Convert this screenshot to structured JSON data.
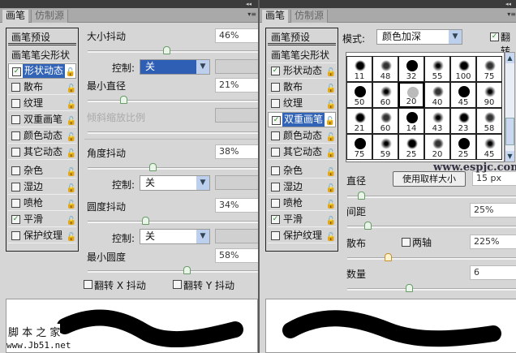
{
  "tabs": {
    "brush": "画笔",
    "clone_source": "仿制源",
    "collapse": "◂◂",
    "menu": "▾≡"
  },
  "left": {
    "list": [
      {
        "label": "画笔预设",
        "type": "head"
      },
      {
        "label": "画笔笔尖形状",
        "type": "head"
      },
      {
        "label": "形状动态",
        "checked": true,
        "selected": true
      },
      {
        "label": "散布",
        "checked": false
      },
      {
        "label": "纹理",
        "checked": false
      },
      {
        "label": "双重画笔",
        "checked": false
      },
      {
        "label": "颜色动态",
        "checked": false
      },
      {
        "label": "其它动态",
        "checked": false
      },
      {
        "label": "杂色",
        "checked": false
      },
      {
        "label": "湿边",
        "checked": false
      },
      {
        "label": "喷枪",
        "checked": false
      },
      {
        "label": "平滑",
        "checked": true
      },
      {
        "label": "保护纹理",
        "checked": false
      }
    ],
    "size_jitter": {
      "label": "大小抖动",
      "value": "46%",
      "slider": 46
    },
    "control1": {
      "label": "控制:",
      "value": "关"
    },
    "min_diameter": {
      "label": "最小直径",
      "value": "21%",
      "slider": 21
    },
    "tilt_scale": {
      "label": "倾斜缩放比例"
    },
    "angle_jitter": {
      "label": "角度抖动",
      "value": "38%",
      "slider": 38
    },
    "control2": {
      "label": "控制:",
      "value": "关"
    },
    "roundness_jitter": {
      "label": "圆度抖动",
      "value": "34%",
      "slider": 34
    },
    "control3": {
      "label": "控制:",
      "value": "关"
    },
    "min_roundness": {
      "label": "最小圆度",
      "value": "58%",
      "slider": 58
    },
    "flip_x": "翻转 X 抖动",
    "flip_y": "翻转 Y 抖动",
    "watermark1": "脚 本 之 家",
    "watermark2": "www.Jb51.net"
  },
  "right": {
    "list": [
      {
        "label": "画笔预设",
        "type": "head"
      },
      {
        "label": "画笔笔尖形状",
        "type": "head"
      },
      {
        "label": "形状动态",
        "checked": true
      },
      {
        "label": "散布",
        "checked": false
      },
      {
        "label": "纹理",
        "checked": false
      },
      {
        "label": "双重画笔",
        "checked": true,
        "selected": true
      },
      {
        "label": "颜色动态",
        "checked": false
      },
      {
        "label": "其它动态",
        "checked": false
      },
      {
        "label": "杂色",
        "checked": false
      },
      {
        "label": "湿边",
        "checked": false
      },
      {
        "label": "喷枪",
        "checked": false
      },
      {
        "label": "平滑",
        "checked": true
      },
      {
        "label": "保护纹理",
        "checked": false
      }
    ],
    "mode": {
      "label": "模式:",
      "value": "颜色加深"
    },
    "flip": {
      "label": "翻转",
      "checked": true
    },
    "brush_sizes": [
      [
        "11",
        "48",
        "32",
        "55",
        "100",
        "75"
      ],
      [
        "50",
        "60",
        "20",
        "40",
        "45",
        "90"
      ],
      [
        "21",
        "60",
        "14",
        "43",
        "23",
        "58"
      ],
      [
        "75",
        "59",
        "25",
        "20",
        "25",
        "45"
      ]
    ],
    "selected_brush": "20",
    "diameter": {
      "label": "直径",
      "button": "使用取样大小",
      "value": "15 px",
      "slider": 8
    },
    "spacing": {
      "label": "间距",
      "value": "25%",
      "slider": 12
    },
    "scatter": {
      "label": "散布",
      "both_axes": "两轴",
      "value": "225%",
      "slider": 24
    },
    "count": {
      "label": "数量",
      "value": "6",
      "slider": 36
    },
    "watermark": "www.espjc.com"
  }
}
